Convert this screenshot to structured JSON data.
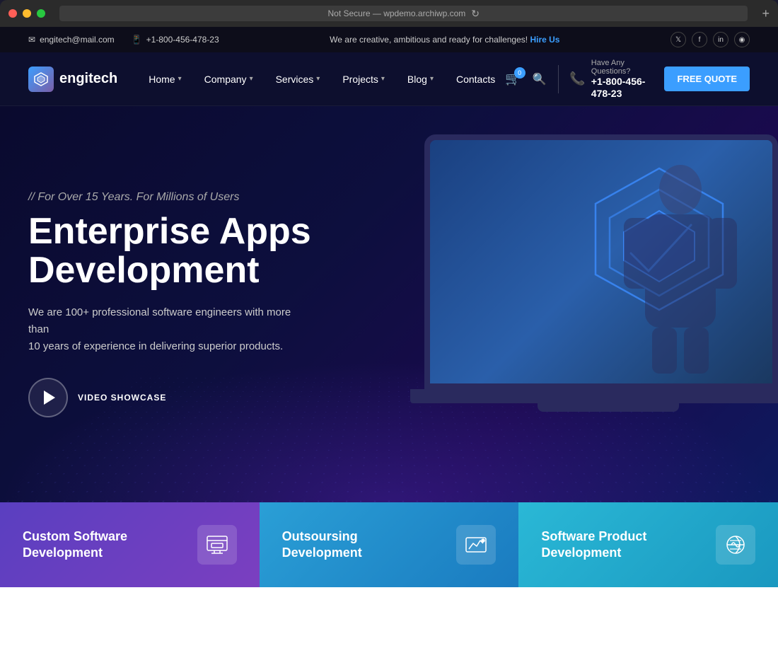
{
  "browser": {
    "address": "Not Secure — wpdemo.archiwp.com",
    "new_tab": "+"
  },
  "topbar": {
    "email_icon": "✉",
    "email": "engitech@mail.com",
    "phone_icon": "📱",
    "phone": "+1-800-456-478-23",
    "promo": "We are creative, ambitious and ready for challenges!",
    "hire_label": "Hire Us",
    "social": [
      "𝕏",
      "f",
      "in",
      "◉"
    ]
  },
  "header": {
    "logo_text": "engitech",
    "nav": [
      {
        "label": "Home",
        "has_arrow": true,
        "active": true
      },
      {
        "label": "Company",
        "has_arrow": true
      },
      {
        "label": "Services",
        "has_arrow": true
      },
      {
        "label": "Projects",
        "has_arrow": true
      },
      {
        "label": "Blog",
        "has_arrow": true
      },
      {
        "label": "Contacts",
        "has_arrow": false
      }
    ],
    "cart_count": "0",
    "have_questions": "Have Any Questions?",
    "phone": "+1-800-456-478-\n23",
    "free_quote": "FREE QUOTE"
  },
  "hero": {
    "eyebrow": "// For Over 15 Years. For Millions of Users",
    "title_line1": "Enterprise Apps",
    "title_line2": "Development",
    "description": "We are 100+ professional software engineers with more than\n10 years of experience in delivering superior products.",
    "video_label": "VIDEO SHOWCASE"
  },
  "services": [
    {
      "title": "Custom Software\nDevelopment",
      "icon": "custom_software"
    },
    {
      "title": "Outsoursing\nDevelopment",
      "icon": "outsourcing"
    },
    {
      "title": "Software Product\nDevelopment",
      "icon": "software_product"
    }
  ],
  "colors": {
    "accent_blue": "#3b9eff",
    "nav_bg": "#0d0f2e",
    "hero_bg": "#0a0a2e",
    "card1": "#6a3fc0",
    "card2": "#2a9fd6",
    "card3": "#2ab8d6"
  }
}
